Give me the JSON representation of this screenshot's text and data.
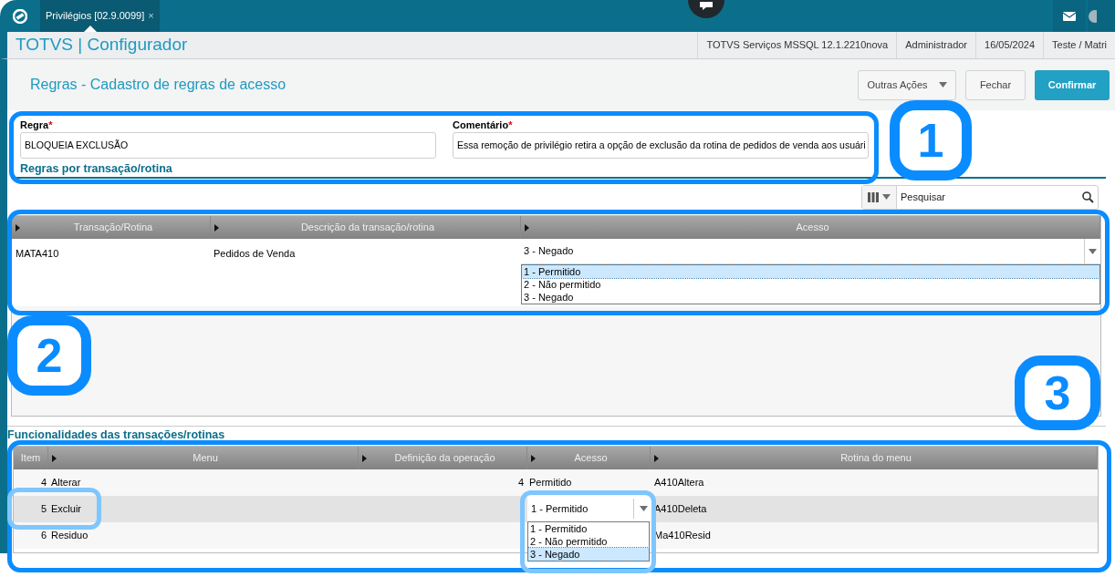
{
  "topbar": {
    "tabs": [
      {
        "label": "Privilégios [02.9.0099]",
        "close": "×",
        "selected": true
      }
    ]
  },
  "header": {
    "title": "TOTVS | Configurador",
    "info": [
      "TOTVS Serviços MSSQL 12.1.2210nova",
      "Administrador",
      "16/05/2024",
      "Teste / Matri"
    ]
  },
  "page": {
    "title": "Regras - Cadastro de regras de acesso",
    "actions": [
      {
        "label": "Outras Ações",
        "kind": "menu"
      },
      {
        "label": "Fechar",
        "kind": "default"
      },
      {
        "label": "Confirmar",
        "kind": "primary"
      }
    ]
  },
  "form": {
    "fields": [
      {
        "label": "Regra",
        "required_mark": "*",
        "value": "BLOQUEIA EXCLUSÃO"
      },
      {
        "label": "Comentário",
        "required_mark": "*",
        "value": "Essa remoção de privilégio retira a opção de exclusão da rotina de pedidos de venda aos usuári"
      }
    ],
    "section": "Regras por transação/rotina"
  },
  "search": {
    "placeholder": "Pesquisar"
  },
  "rules_grid": {
    "columns": [
      "Transação/Rotina",
      "Descrição da transação/rotina",
      "Acesso"
    ],
    "rows": [
      {
        "cells": [
          "MATA410",
          "Pedidos de Venda"
        ],
        "access": {
          "value": "3 - Negado",
          "expanded": true,
          "options": [
            {
              "label": "1 - Permitido",
              "highlighted": true
            },
            {
              "label": "2 - Não permitido",
              "highlighted": false
            },
            {
              "label": "3 - Negado",
              "highlighted": false
            }
          ]
        }
      }
    ]
  },
  "functions_section": "Funcionalidades das transações/rotinas",
  "functions_grid": {
    "columns": [
      "Item",
      "Menu",
      "Definição da operação",
      "Acesso",
      "Rotina do menu"
    ],
    "rows": [
      {
        "item": "4",
        "menu": "Alterar",
        "definition": "4",
        "access": "Permitido",
        "routine": "A410Altera",
        "selected": false
      },
      {
        "item": "5",
        "menu": "Excluir",
        "access_select": {
          "value": "1 - Permitido",
          "expanded": true,
          "options": [
            {
              "label": "1 - Permitido",
              "highlighted": false
            },
            {
              "label": "2 - Não permitido",
              "highlighted": false
            },
            {
              "label": "3 - Negado",
              "highlighted": true
            }
          ]
        },
        "routine": "A410Deleta",
        "selected": true
      },
      {
        "item": "6",
        "menu": "Residuo",
        "routine": "Ma410Resid",
        "selected": false
      }
    ]
  },
  "annotations": [
    {
      "kind": "badge",
      "label": "1"
    },
    {
      "kind": "badge",
      "label": "2"
    },
    {
      "kind": "badge",
      "label": "3"
    }
  ]
}
